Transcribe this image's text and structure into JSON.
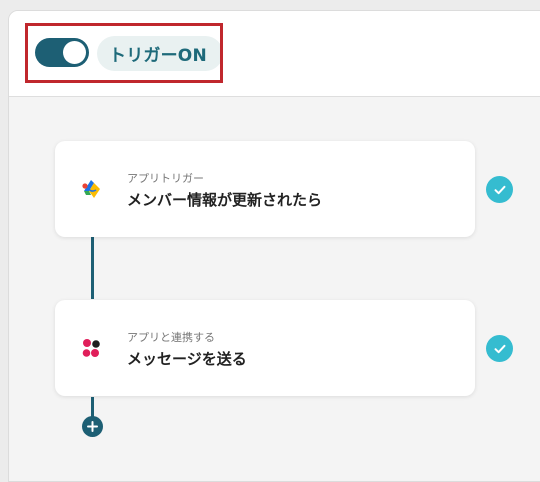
{
  "header": {
    "trigger_toggle_on": true,
    "trigger_status_label": "トリガーON"
  },
  "flow": {
    "steps": [
      {
        "subtitle": "アプリトリガー",
        "title": "メンバー情報が更新されたら",
        "icon": "google-workspace-icon",
        "completed": true
      },
      {
        "subtitle": "アプリと連携する",
        "title": "メッセージを送る",
        "icon": "app-integration-icon",
        "completed": true
      }
    ],
    "add_step_icon": "plus-icon"
  },
  "colors": {
    "accent": "#1d5f74",
    "trigger_label": "#1e6a7a",
    "check": "#35bcd0",
    "highlight_border": "#c0272d"
  }
}
